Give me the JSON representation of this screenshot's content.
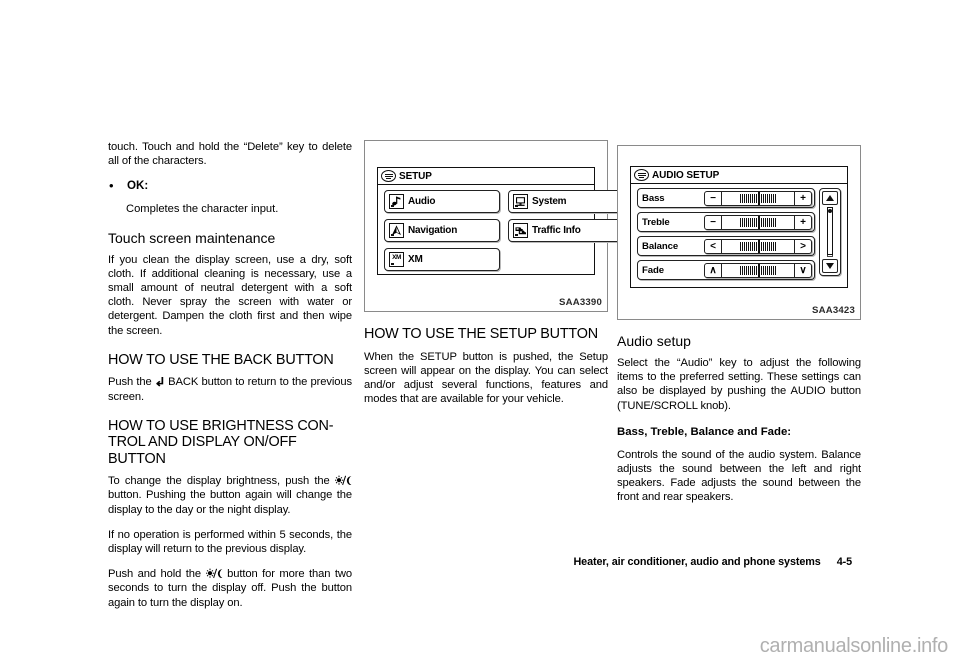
{
  "document": {
    "footer_title": "Heater, air conditioner, audio and phone systems",
    "footer_page": "4-5",
    "watermark": "carmanualsonline.info"
  },
  "column_left": {
    "para_continuation": "touch. Touch and hold the “Delete” key to delete all of the characters.",
    "bullet": {
      "marker": "•",
      "label": "OK:",
      "description": "Completes the character input."
    },
    "heading_touch_maintenance": "Touch screen maintenance",
    "para_maintenance": "If you clean the display screen, use a dry, soft cloth. If additional cleaning is necessary, use a small amount of neutral detergent with a soft cloth. Never spray the screen with water or detergent. Dampen the cloth first and then wipe the screen.",
    "heading_back_button": "HOW TO USE THE BACK BUTTON",
    "para_back_pre": "Push the",
    "para_back_post": "BACK button to return to the previous screen.",
    "heading_brightness": "HOW TO USE BRIGHTNESS CON-TROL AND DISPLAY ON/OFF BUTTON",
    "para_brightness_pre": "To change the display brightness, push the",
    "para_brightness_post": "button. Pushing the button again will change the display to the day or the night display.",
    "para_timeout": "If no operation is performed within 5 seconds, the display will return to the previous display.",
    "para_hold_pre": "Push and hold the",
    "para_hold_post": "button for more than two seconds to turn the display off. Push the button again to turn the display on."
  },
  "column_middle": {
    "figure": {
      "caption": "SAA3390",
      "screen_title": "SETUP",
      "buttons_left": [
        {
          "label": "Audio",
          "icon": "music-note-icon",
          "glyph": "♪"
        },
        {
          "label": "Navigation",
          "icon": "navigation-arrow-icon",
          "glyph": "▲"
        },
        {
          "label": "XM",
          "icon": "xm-icon",
          "glyph": "XM"
        }
      ],
      "buttons_right": [
        {
          "label": "System",
          "icon": "monitor-icon",
          "glyph": "⬛"
        },
        {
          "label": "Traffic Info",
          "icon": "traffic-car-icon",
          "glyph": "◨"
        }
      ]
    },
    "heading_setup_button": "HOW TO USE THE SETUP BUTTON",
    "para_setup": "When the SETUP button is pushed, the Setup screen will appear on the display. You can select and/or adjust several functions, features and modes that are available for your vehicle."
  },
  "column_right": {
    "figure": {
      "caption": "SAA3423",
      "screen_title": "AUDIO SETUP",
      "rows": [
        {
          "label": "Bass",
          "dec": "−",
          "inc": "+"
        },
        {
          "label": "Treble",
          "dec": "−",
          "inc": "+"
        },
        {
          "label": "Balance",
          "dec": "<",
          "inc": ">"
        },
        {
          "label": "Fade",
          "dec": "∧",
          "inc": "∨"
        }
      ],
      "scrollbar": {
        "up": "▲",
        "down": "▼"
      }
    },
    "heading_audio_setup": "Audio setup",
    "para_audio_setup": "Select the “Audio” key to adjust the following items to the preferred setting. These settings can also be displayed by pushing the AUDIO button (TUNE/SCROLL knob).",
    "heading_bass_treble": "Bass, Treble, Balance and Fade:",
    "para_bass_treble": "Controls the sound of the audio system. Balance adjusts the sound between the left and right speakers. Fade adjusts the sound between the front and rear speakers."
  }
}
